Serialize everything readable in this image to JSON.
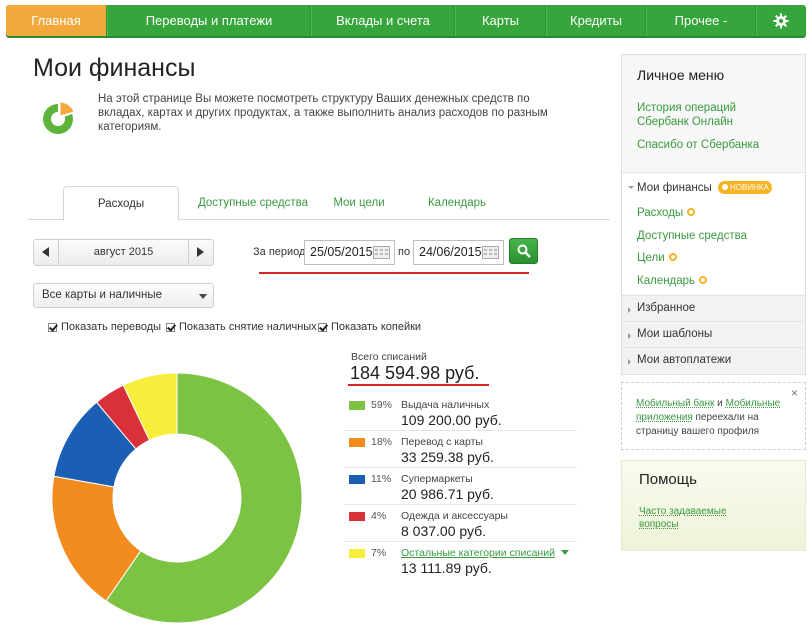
{
  "nav": {
    "items": [
      {
        "label": "Главная",
        "width": 101,
        "active": true
      },
      {
        "label": "Переводы и платежи",
        "width": 204
      },
      {
        "label": "Вклады и счета",
        "width": 144
      },
      {
        "label": "Карты",
        "width": 91
      },
      {
        "label": "Кредиты",
        "width": 100
      },
      {
        "label": "Прочее -",
        "width": 110
      }
    ]
  },
  "page": {
    "title": "Мои финансы",
    "intro": "На этой странице Вы можете посмотреть структуру Ваших денежных средств по вкладах, картах и других продуктах, а также выполнить анализ расходов по разным категориям."
  },
  "tabs": [
    "Расходы",
    "Доступные средства",
    "Мои цели",
    "Календарь"
  ],
  "filters": {
    "month": "август 2015",
    "period_label": "За период",
    "date_from": "25/05/2015",
    "to_label": "по",
    "date_to": "24/06/2015",
    "cards_select": "Все карты и наличные",
    "checkboxes": [
      "Показать переводы",
      "Показать снятие наличных",
      "Показать копейки"
    ]
  },
  "summary": {
    "total_label": "Всего списаний",
    "total_value": "184 594.98 руб."
  },
  "chart_data": {
    "type": "pie",
    "categories": [
      "Выдача наличных",
      "Перевод с карты",
      "Супермаркеты",
      "Одежда и аксессуары",
      "Остальные категории списаний"
    ],
    "values": [
      59,
      18,
      11,
      4,
      7
    ],
    "percent_labels": [
      "59%",
      "18%",
      "11%",
      "4%",
      "7%"
    ],
    "amounts": [
      "109 200.00 руб.",
      "33 259.38 руб.",
      "20 986.71 руб.",
      "8 037.00 руб.",
      "13 111.89 руб."
    ],
    "colors": [
      "#7cc243",
      "#f28c1e",
      "#1a5fb4",
      "#d9303a",
      "#f7ee3c"
    ],
    "donut": true
  },
  "sidebar": {
    "menu_title": "Личное меню",
    "history_link": "История операций Сбербанк Онлайн",
    "spasibo_link": "Спасибо от Сбербанка",
    "finance_title": "Мои финансы",
    "badge": "НОВИНКА",
    "finance_links": [
      "Расходы",
      "Доступные средства",
      "Цели",
      "Календарь"
    ],
    "sections": [
      "Избранное",
      "Мои шаблоны",
      "Мои автоплатежи"
    ],
    "notice_link1": "Мобильный банк",
    "notice_and": " и ",
    "notice_link2": "Мобильные приложения",
    "notice_text": " переехали на страницу вашего профиля",
    "help_title": "Помощь",
    "faq_link": "Часто задаваемые вопросы"
  }
}
